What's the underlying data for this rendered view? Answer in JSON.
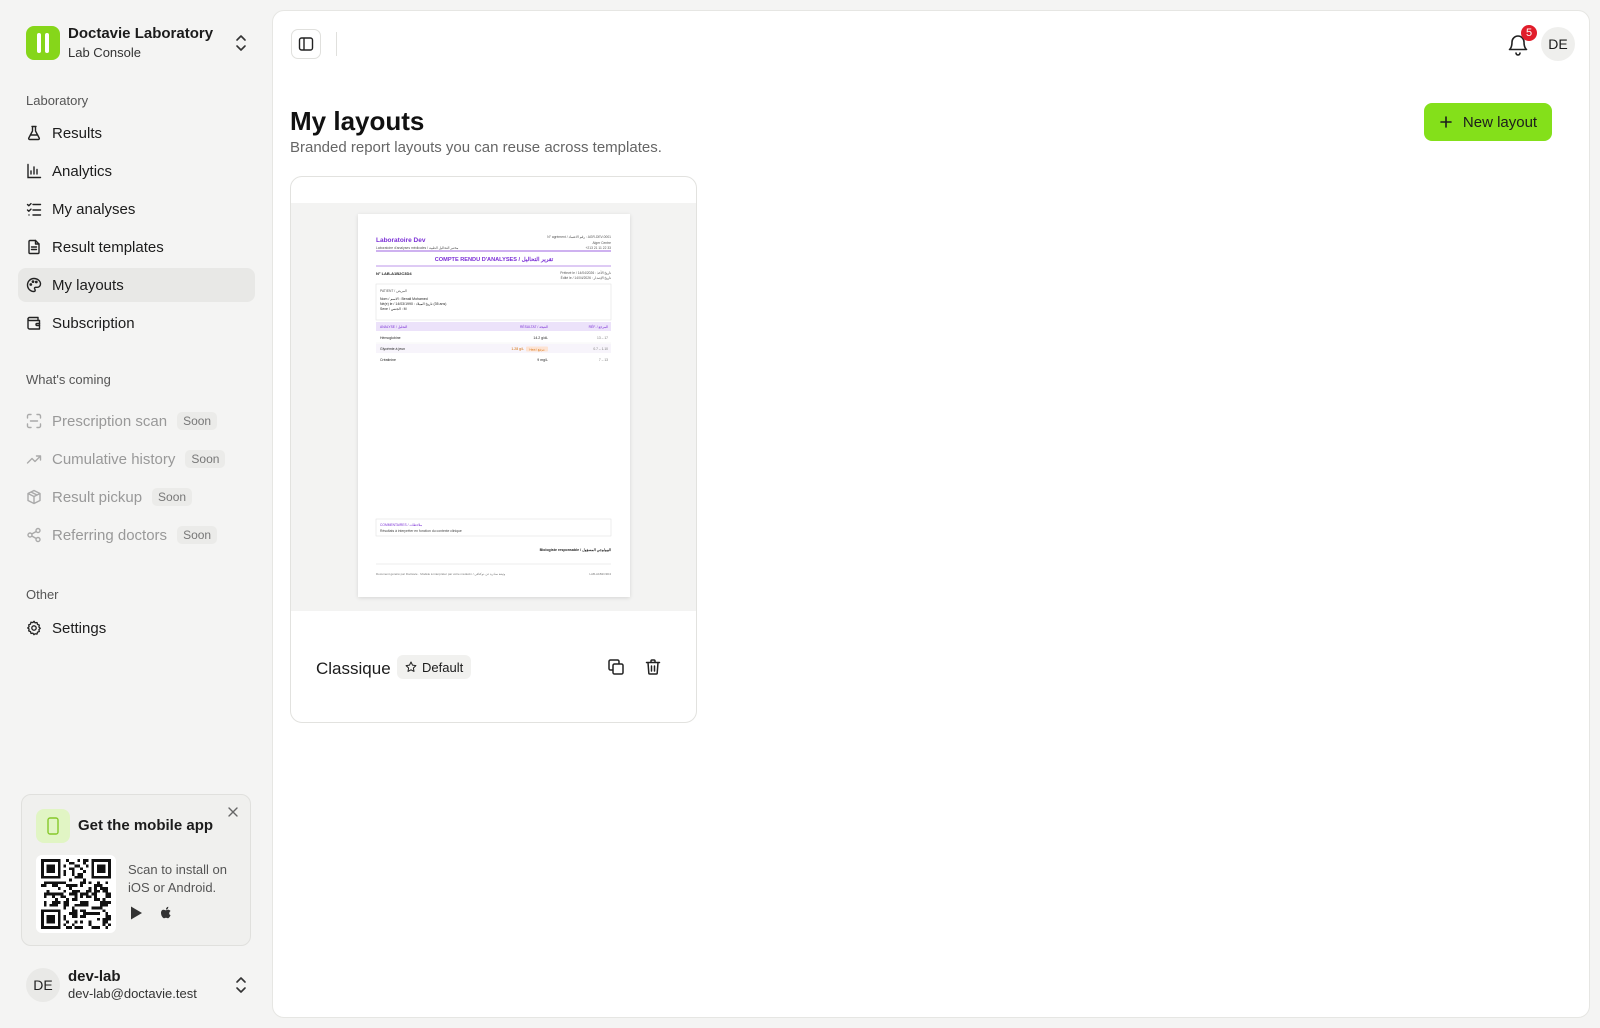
{
  "brand": {
    "name": "Doctavie Laboratory",
    "subtitle": "Lab Console",
    "icon": "logo-icon",
    "accent": "#86d61a"
  },
  "sidebar": {
    "section1": "Laboratory",
    "items": [
      {
        "label": "Results",
        "icon": "flask-icon"
      },
      {
        "label": "Analytics",
        "icon": "bar-chart-icon"
      },
      {
        "label": "My analyses",
        "icon": "list-check-icon"
      },
      {
        "label": "Result templates",
        "icon": "file-text-icon"
      },
      {
        "label": "My layouts",
        "icon": "palette-icon",
        "active": true
      },
      {
        "label": "Subscription",
        "icon": "wallet-icon"
      }
    ],
    "section2": "What's coming",
    "coming": [
      {
        "label": "Prescription scan",
        "icon": "scan-icon",
        "badge": "Soon"
      },
      {
        "label": "Cumulative history",
        "icon": "trending-up-icon",
        "badge": "Soon"
      },
      {
        "label": "Result pickup",
        "icon": "package-icon",
        "badge": "Soon"
      },
      {
        "label": "Referring doctors",
        "icon": "share-icon",
        "badge": "Soon"
      }
    ],
    "section3": "Other",
    "other": [
      {
        "label": "Settings",
        "icon": "gear-icon"
      }
    ]
  },
  "promo": {
    "title": "Get the mobile app",
    "description": "Scan to install on iOS or Android.",
    "stores": [
      "google-play-icon",
      "apple-icon"
    ]
  },
  "user": {
    "initials": "DE",
    "name": "dev-lab",
    "email": "dev-lab@doctavie.test"
  },
  "topbar": {
    "notifications": "5",
    "avatar": "DE"
  },
  "page": {
    "title": "My layouts",
    "subtitle": "Branded report layouts you can reuse across templates.",
    "new_button": "New layout"
  },
  "layouts": [
    {
      "name": "Classique",
      "badge": "Default",
      "preview": {
        "lab_name": "Laboratoire Dev",
        "lab_sub": "Laboratoire d'analyses médicales / مختبر التحاليل الطبية",
        "agreement": "N° agrément / رقم الاعتماد : AGR-DEV-0001",
        "city": "Alger Centre",
        "phone": "+213 21 11 22 33",
        "report_title": "COMPTE RENDU D'ANALYSES / تقرير التحاليل",
        "report_no": "N° LAB-A1B2C3D4",
        "sampled": "Prélevé le / تاريخ الأخذ : 14/04/2026",
        "edited": "Édité le / تاريخ الإصدار : 14/04/2026",
        "patient_label": "PATIENT / المريض",
        "patient_name": "Nom / الاسم : Benali Mohamed",
        "patient_dob": "Né(e) le / تاريخ الميلاد : 14/03/1990 (35 ans)",
        "patient_sex": "Sexe / الجنس : M",
        "col_analysis": "ANALYSE / التحليل",
        "col_result": "RÉSULTAT / النتيجة",
        "col_ref": "RÉF. / المرجع",
        "rows": [
          {
            "name": "Hémoglobine",
            "value": "14.2 g/dL",
            "flag": "",
            "ref": "13 – 17"
          },
          {
            "name": "Glycémie à jeun",
            "value": "1.28 g/L",
            "flag": "Haut / مرتفع",
            "ref": "0.7 – 1.10"
          },
          {
            "name": "Créatinine",
            "value": "9 mg/L",
            "flag": "",
            "ref": "7 – 13"
          }
        ],
        "comments_label": "COMMENTAIRES / ملاحظات",
        "comments": "Résultats à interpréter en fonction du contexte clinique",
        "biologist": "Biologiste responsable / البيولوجي المسؤول",
        "footer_left": "Document généré par Doctavie · Modèle à interpréter par votre médecin / وثيقة صادرة عن دوكتافي",
        "footer_right": "LAB-A1B2C3D4",
        "accent": "#7b2fd6"
      },
      "actions": [
        "copy-icon",
        "trash-icon"
      ]
    }
  ]
}
